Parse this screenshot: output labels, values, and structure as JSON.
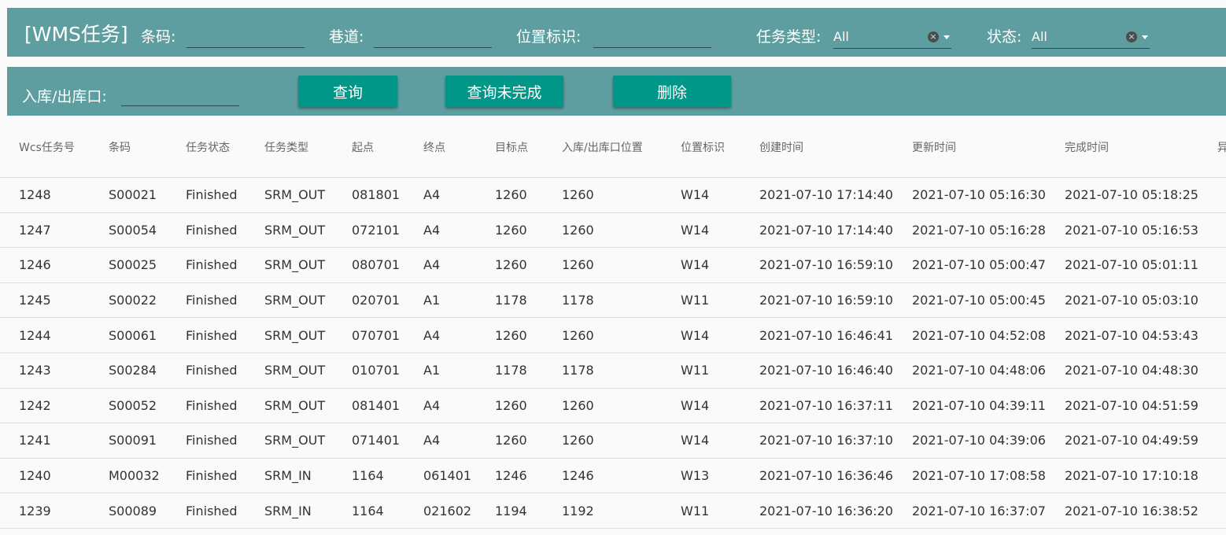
{
  "header": {
    "title": "[WMS任务]",
    "barcode_label": "条码:",
    "lane_label": "巷道:",
    "location_label": "位置标识:",
    "task_type_label": "任务类型:",
    "task_type_value": "All",
    "status_label": "状态:",
    "status_value": "All"
  },
  "filters": {
    "port_label": "入库/出库口:"
  },
  "buttons": {
    "query": "查询",
    "query_unfinished": "查询未完成",
    "delete": "删除"
  },
  "table": {
    "columns": [
      "Wcs任务号",
      "条码",
      "任务状态",
      "任务类型",
      "起点",
      "终点",
      "目标点",
      "入库/出库口位置",
      "位置标识",
      "创建时间",
      "更新时间",
      "完成时间",
      "异"
    ],
    "rows": [
      [
        "1248",
        "S00021",
        "Finished",
        "SRM_OUT",
        "081801",
        "A4",
        "1260",
        "1260",
        "W14",
        "2021-07-10 17:14:40",
        "2021-07-10 05:16:30",
        "2021-07-10 05:18:25",
        ""
      ],
      [
        "1247",
        "S00054",
        "Finished",
        "SRM_OUT",
        "072101",
        "A4",
        "1260",
        "1260",
        "W14",
        "2021-07-10 17:14:40",
        "2021-07-10 05:16:28",
        "2021-07-10 05:16:53",
        ""
      ],
      [
        "1246",
        "S00025",
        "Finished",
        "SRM_OUT",
        "080701",
        "A4",
        "1260",
        "1260",
        "W14",
        "2021-07-10 16:59:10",
        "2021-07-10 05:00:47",
        "2021-07-10 05:01:11",
        ""
      ],
      [
        "1245",
        "S00022",
        "Finished",
        "SRM_OUT",
        "020701",
        "A1",
        "1178",
        "1178",
        "W11",
        "2021-07-10 16:59:10",
        "2021-07-10 05:00:45",
        "2021-07-10 05:03:10",
        ""
      ],
      [
        "1244",
        "S00061",
        "Finished",
        "SRM_OUT",
        "070701",
        "A4",
        "1260",
        "1260",
        "W14",
        "2021-07-10 16:46:41",
        "2021-07-10 04:52:08",
        "2021-07-10 04:53:43",
        ""
      ],
      [
        "1243",
        "S00284",
        "Finished",
        "SRM_OUT",
        "010701",
        "A1",
        "1178",
        "1178",
        "W11",
        "2021-07-10 16:46:40",
        "2021-07-10 04:48:06",
        "2021-07-10 04:48:30",
        ""
      ],
      [
        "1242",
        "S00052",
        "Finished",
        "SRM_OUT",
        "081401",
        "A4",
        "1260",
        "1260",
        "W14",
        "2021-07-10 16:37:11",
        "2021-07-10 04:39:11",
        "2021-07-10 04:51:59",
        ""
      ],
      [
        "1241",
        "S00091",
        "Finished",
        "SRM_OUT",
        "071401",
        "A4",
        "1260",
        "1260",
        "W14",
        "2021-07-10 16:37:10",
        "2021-07-10 04:39:06",
        "2021-07-10 04:49:59",
        ""
      ],
      [
        "1240",
        "M00032",
        "Finished",
        "SRM_IN",
        "1164",
        "061401",
        "1246",
        "1246",
        "W13",
        "2021-07-10 16:36:46",
        "2021-07-10 17:08:58",
        "2021-07-10 17:10:18",
        ""
      ],
      [
        "1239",
        "S00089",
        "Finished",
        "SRM_IN",
        "1164",
        "021602",
        "1194",
        "1192",
        "W11",
        "2021-07-10 16:36:20",
        "2021-07-10 16:37:07",
        "2021-07-10 16:38:52",
        ""
      ]
    ]
  }
}
